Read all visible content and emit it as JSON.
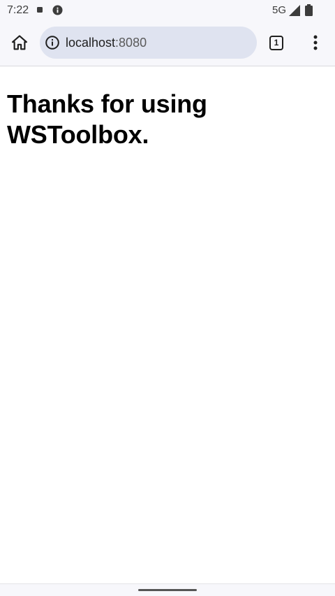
{
  "status_bar": {
    "time": "7:22",
    "network": "5G",
    "icons": [
      "notification-square-icon",
      "info-icon",
      "signal-icon",
      "battery-icon"
    ]
  },
  "browser": {
    "home_icon": "home-icon",
    "site_info_icon": "info-icon",
    "url_host": "localhost",
    "url_port": ":8080",
    "tab_count": "1",
    "menu_icon": "more-vert-icon"
  },
  "page": {
    "headline": "Thanks for using WSToolbox."
  },
  "colors": {
    "chrome_background": "#f7f7fb",
    "omnibox_background": "#dfe3f0",
    "text_primary": "#000000"
  }
}
